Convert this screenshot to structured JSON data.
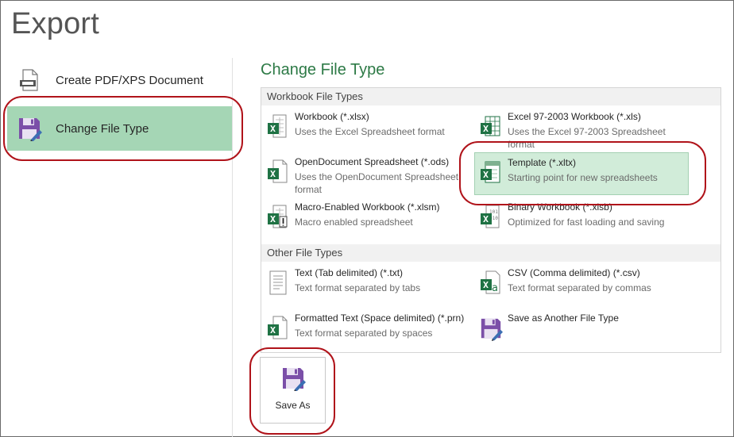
{
  "page": {
    "title": "Export"
  },
  "nav": {
    "items": [
      {
        "label": "Create PDF/XPS Document",
        "icon": "pdf-document-icon"
      },
      {
        "label": "Change File Type",
        "icon": "floppy-save-icon",
        "selected": true
      }
    ]
  },
  "main": {
    "title": "Change File Type",
    "groups": [
      {
        "header": "Workbook File Types",
        "items": [
          {
            "name": "Workbook (*.xlsx)",
            "desc": "Uses the Excel Spreadsheet format",
            "icon": "excel-workbook-icon"
          },
          {
            "name": "Excel 97-2003 Workbook (*.xls)",
            "desc": "Uses the Excel 97-2003 Spreadsheet format",
            "icon": "excel-97-workbook-icon"
          },
          {
            "name": "OpenDocument Spreadsheet (*.ods)",
            "desc": "Uses the OpenDocument Spreadsheet format",
            "icon": "opendocument-spreadsheet-icon"
          },
          {
            "name": "Template (*.xltx)",
            "desc": "Starting point for new spreadsheets",
            "icon": "excel-template-icon",
            "selected": true
          },
          {
            "name": "Macro-Enabled Workbook (*.xlsm)",
            "desc": "Macro enabled spreadsheet",
            "icon": "excel-macro-workbook-icon"
          },
          {
            "name": "Binary Workbook (*.xlsb)",
            "desc": "Optimized for fast loading and saving",
            "icon": "excel-binary-workbook-icon"
          }
        ]
      },
      {
        "header": "Other File Types",
        "items": [
          {
            "name": "Text (Tab delimited) (*.txt)",
            "desc": "Text format separated by tabs",
            "icon": "text-file-icon"
          },
          {
            "name": "CSV (Comma delimited) (*.csv)",
            "desc": "Text format separated by commas",
            "icon": "csv-file-icon"
          },
          {
            "name": "Formatted Text (Space delimited) (*.prn)",
            "desc": "Text format separated by spaces",
            "icon": "formatted-text-file-icon"
          },
          {
            "name": "Save as Another File Type",
            "desc": "",
            "icon": "floppy-save-icon"
          }
        ]
      }
    ],
    "save_as": {
      "label": "Save As",
      "icon": "floppy-save-icon"
    }
  },
  "colors": {
    "accent_green": "#2d7a46",
    "nav_selected_bg": "#a5d6b5",
    "item_selected_bg": "#d1ecd9",
    "annotation_red": "#b0131a",
    "excel_green": "#1f7244",
    "floppy_purple": "#7b4fa8"
  }
}
